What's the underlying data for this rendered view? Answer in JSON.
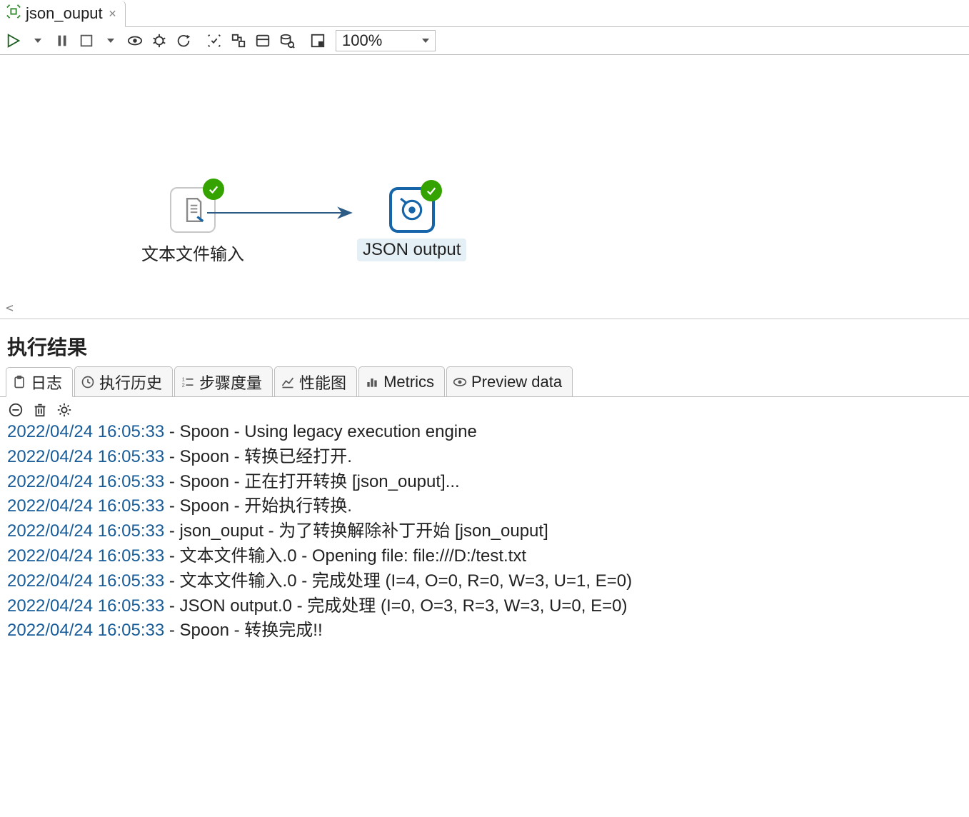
{
  "tab": {
    "title": "json_ouput"
  },
  "toolbar": {
    "zoom": "100%"
  },
  "canvas": {
    "nodes": [
      {
        "id": "n1",
        "label": "文本文件输入",
        "selected": false
      },
      {
        "id": "n2",
        "label": "JSON output",
        "selected": true
      }
    ]
  },
  "results": {
    "header": "执行结果",
    "tabs": [
      {
        "id": "log",
        "label": "日志"
      },
      {
        "id": "history",
        "label": "执行历史"
      },
      {
        "id": "stepmetrics",
        "label": "步骤度量"
      },
      {
        "id": "perf",
        "label": "性能图"
      },
      {
        "id": "metrics",
        "label": "Metrics"
      },
      {
        "id": "preview",
        "label": "Preview data"
      }
    ],
    "active_tab": "log",
    "log": [
      {
        "ts": "2022/04/24 16:05:33",
        "src": "Spoon",
        "msg": "Using legacy execution engine"
      },
      {
        "ts": "2022/04/24 16:05:33",
        "src": "Spoon",
        "msg": "转换已经打开."
      },
      {
        "ts": "2022/04/24 16:05:33",
        "src": "Spoon",
        "msg": "正在打开转换 [json_ouput]..."
      },
      {
        "ts": "2022/04/24 16:05:33",
        "src": "Spoon",
        "msg": "开始执行转换."
      },
      {
        "ts": "2022/04/24 16:05:33",
        "src": "json_ouput",
        "msg": "为了转换解除补丁开始  [json_ouput]"
      },
      {
        "ts": "2022/04/24 16:05:33",
        "src": "文本文件输入.0",
        "msg": "Opening file: file:///D:/test.txt"
      },
      {
        "ts": "2022/04/24 16:05:33",
        "src": "文本文件输入.0",
        "msg": "完成处理 (I=4, O=0, R=0, W=3, U=1, E=0)"
      },
      {
        "ts": "2022/04/24 16:05:33",
        "src": "JSON output.0",
        "msg": "完成处理 (I=0, O=3, R=3, W=3, U=0, E=0)"
      },
      {
        "ts": "2022/04/24 16:05:33",
        "src": "Spoon",
        "msg": "转换完成!!"
      }
    ]
  }
}
